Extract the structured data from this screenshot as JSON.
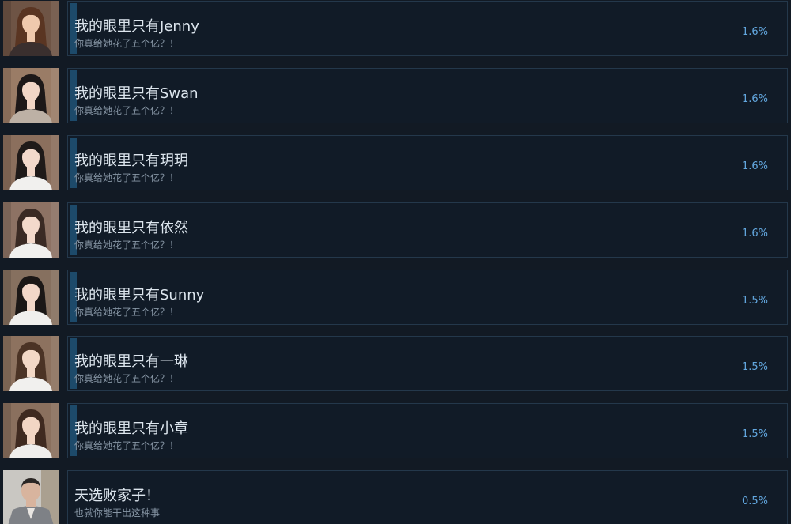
{
  "achievements": [
    {
      "title": "我的眼里只有Jenny",
      "description": "你真给她花了五个亿？！",
      "percent": "1.6%",
      "portrait": {
        "bg": "#6e5445",
        "hair": "#5a3522",
        "skin": "#efc9ad",
        "cloth": "#3a2f2e"
      }
    },
    {
      "title": "我的眼里只有Swan",
      "description": "你真给她花了五个亿？！",
      "percent": "1.6%",
      "portrait": {
        "bg": "#9a7c66",
        "hair": "#1d1818",
        "skin": "#f2d6c6",
        "cloth": "#bdb1a5"
      }
    },
    {
      "title": "我的眼里只有玥玥",
      "description": "你真给她花了五个亿？！",
      "percent": "1.6%",
      "portrait": {
        "bg": "#8b6f5d",
        "hair": "#1f1a19",
        "skin": "#f3d9cb",
        "cloth": "#f1f0ee"
      }
    },
    {
      "title": "我的眼里只有依然",
      "description": "你真给她花了五个亿？！",
      "percent": "1.6%",
      "portrait": {
        "bg": "#8d7264",
        "hair": "#3a2a24",
        "skin": "#f3d9cb",
        "cloth": "#f1f0ee"
      }
    },
    {
      "title": "我的眼里只有Sunny",
      "description": "你真给她花了五个亿？！",
      "percent": "1.5%",
      "portrait": {
        "bg": "#86705f",
        "hair": "#1b1716",
        "skin": "#f2d7c8",
        "cloth": "#f0efed"
      }
    },
    {
      "title": "我的眼里只有一琳",
      "description": "你真给她花了五个亿？！",
      "percent": "1.5%",
      "portrait": {
        "bg": "#8d725f",
        "hair": "#4b3325",
        "skin": "#f3d8c6",
        "cloth": "#f1f0ee"
      }
    },
    {
      "title": "我的眼里只有小章",
      "description": "你真给她花了五个亿？！",
      "percent": "1.5%",
      "portrait": {
        "bg": "#8a705e",
        "hair": "#3f2a20",
        "skin": "#f2d6c4",
        "cloth": "#efeeec"
      }
    },
    {
      "title": "天选败家子！",
      "description": "也就你能干出这种事",
      "percent": "0.5%",
      "portrait": {
        "bg": "#c9c7c2",
        "hair": "#2a2624",
        "skin": "#d8b49e",
        "cloth": "#7e8186"
      }
    }
  ],
  "progress_fill": [
    0.016,
    0.016,
    0.016,
    0.016,
    0.015,
    0.015,
    0.015,
    0.005
  ]
}
